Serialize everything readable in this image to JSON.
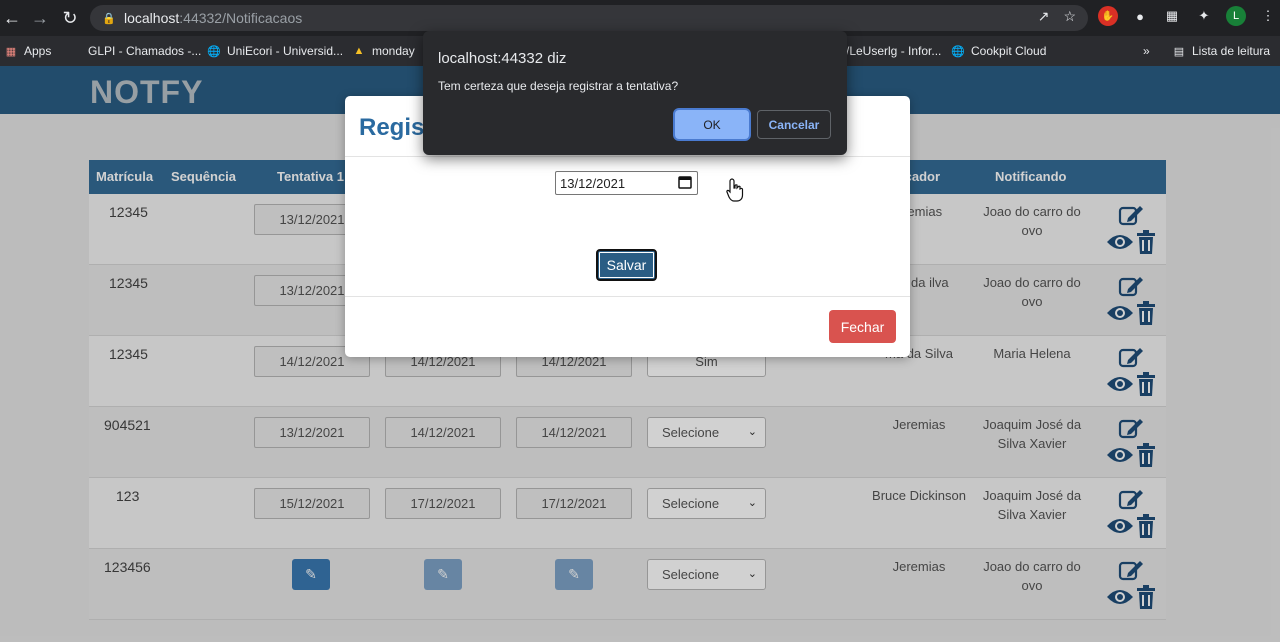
{
  "browser": {
    "url_host": "localhost",
    "url_rest": ":44332/Notificacaos",
    "profile_initial": "L",
    "bookmarks": {
      "apps": "Apps",
      "glpi": "GLPI - Chamados -...",
      "uniecori": "UniEcori - Universid...",
      "monday": "monday",
      "leuserlg": "/LeUserlg - Infor...",
      "cookpit": "Cookpit Cloud",
      "more": "»",
      "reading_list": "Lista de leitura"
    }
  },
  "app": {
    "logo": "NOTFY"
  },
  "table": {
    "headers": {
      "matricula": "Matrícula",
      "sequencia": "Sequência",
      "tentativa1": "Tentativa 1",
      "notificador": "icador",
      "notificando": "Notificando"
    },
    "rows": [
      {
        "matricula": "12345",
        "t1": "13/12/2021",
        "notificador": "eremias",
        "notificando": "Joao do carro do ovo"
      },
      {
        "matricula": "12345",
        "t1": "13/12/2021",
        "notificador": "ma da ilva",
        "notificando": "Joao do carro do ovo"
      },
      {
        "matricula": "12345",
        "t1": "14/12/2021",
        "t2": "14/12/2021",
        "t3": "14/12/2021",
        "status": "Sim",
        "notificador": "ma da Silva",
        "notificando": "Maria Helena"
      },
      {
        "matricula": "904521",
        "t1": "13/12/2021",
        "t2": "14/12/2021",
        "t3": "14/12/2021",
        "status": "Selecione",
        "notificador": "Jeremias",
        "notificando": "Joaquim José da Silva Xavier"
      },
      {
        "matricula": "123",
        "t1": "15/12/2021",
        "t2": "17/12/2021",
        "t3": "17/12/2021",
        "status": "Selecione",
        "notificador": "Bruce Dickinson",
        "notificando": "Joaquim José da Silva Xavier"
      },
      {
        "matricula": "123456",
        "status": "Selecione",
        "notificador": "Jeremias",
        "notificando": "Joao do carro do ovo"
      }
    ]
  },
  "modal": {
    "title": "Regist",
    "date_value": "13/12/2021",
    "save_label": "Salvar",
    "close_label": "Fechar"
  },
  "alert": {
    "title": "localhost:44332 diz",
    "message": "Tem certeza que deseja registrar a tentativa?",
    "ok_label": "OK",
    "cancel_label": "Cancelar"
  }
}
